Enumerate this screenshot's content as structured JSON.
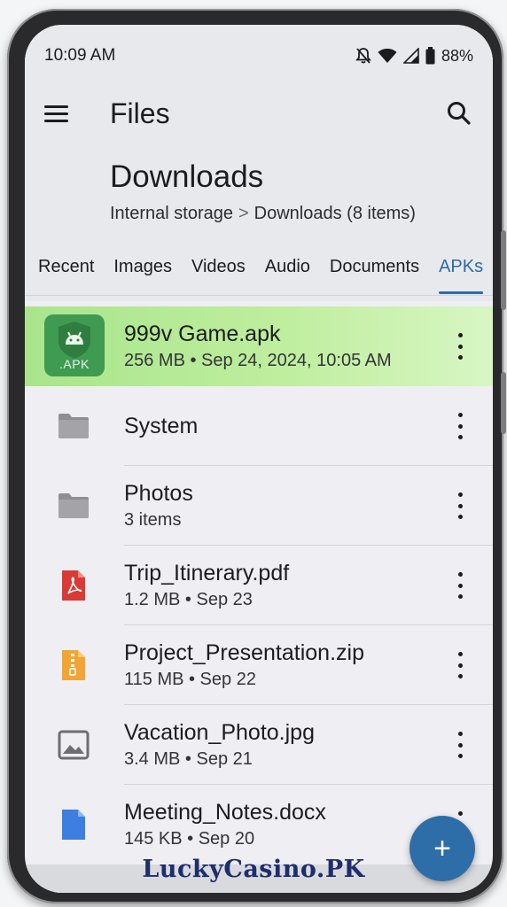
{
  "status": {
    "time": "10:09 AM",
    "battery": "88%"
  },
  "appbar": {
    "title": "Files"
  },
  "folder": {
    "title": "Downloads",
    "crumb_root": "Internal storage",
    "crumb_sep": ">",
    "crumb_current": "Downloads (8 items)"
  },
  "tabs": [
    {
      "label": "Recent"
    },
    {
      "label": "Images"
    },
    {
      "label": "Videos"
    },
    {
      "label": "Audio"
    },
    {
      "label": "Documents"
    },
    {
      "label": "APKs"
    }
  ],
  "items": [
    {
      "name": "999v Game.apk",
      "meta": "256 MB • Sep 24, 2024, 10:05 AM",
      "icon": "apk-icon",
      "icon_label": ".APK",
      "highlighted": true
    },
    {
      "name": "System",
      "meta": "",
      "icon": "folder-icon"
    },
    {
      "name": "Photos",
      "meta": "3 items",
      "icon": "folder-icon"
    },
    {
      "name": "Trip_Itinerary.pdf",
      "meta": "1.2 MB • Sep 23",
      "icon": "pdf-icon"
    },
    {
      "name": "Project_Presentation.zip",
      "meta": "115 MB • Sep 22",
      "icon": "zip-icon"
    },
    {
      "name": "Vacation_Photo.jpg",
      "meta": "3.4 MB • Sep 21",
      "icon": "image-icon"
    },
    {
      "name": "Meeting_Notes.docx",
      "meta": "145 KB • Sep 20",
      "icon": "doc-icon"
    }
  ],
  "fab": {
    "label": "+"
  },
  "watermark": "LuckyCasino.PK",
  "colors": {
    "accent": "#2c6ba8",
    "highlight": "#b6ea96",
    "pdf": "#d93a35",
    "zip": "#f2a531",
    "doc": "#3d7ee0",
    "apk": "#3f9a52"
  }
}
